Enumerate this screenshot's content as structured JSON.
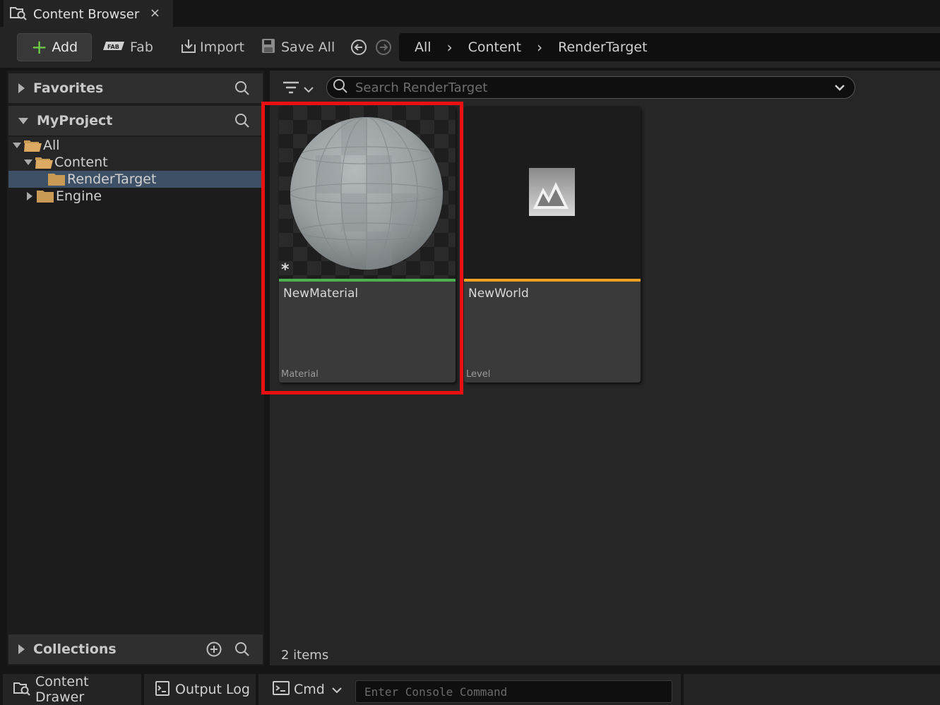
{
  "tab": {
    "title": "Content Browser",
    "close": "×"
  },
  "toolbar": {
    "add_label": "Add",
    "fab_label": "Fab",
    "import_label": "Import",
    "save_all_label": "Save All"
  },
  "breadcrumb": [
    "All",
    "Content",
    "RenderTarget"
  ],
  "sidebar": {
    "favorites_label": "Favorites",
    "project_label": "MyProject",
    "tree": [
      {
        "label": "All",
        "expanded": true
      },
      {
        "label": "Content",
        "expanded": true
      },
      {
        "label": "RenderTarget",
        "selected": true
      },
      {
        "label": "Engine",
        "expanded": false
      }
    ],
    "collections_label": "Collections"
  },
  "search": {
    "placeholder": "Search RenderTarget"
  },
  "assets": [
    {
      "name": "NewMaterial",
      "type": "Material",
      "bar_color": "#4caf50"
    },
    {
      "name": "NewWorld",
      "type": "Level",
      "bar_color": "#f0a020"
    }
  ],
  "status": {
    "item_count": "2 items"
  },
  "bottom": {
    "content_drawer": "Content Drawer",
    "output_log": "Output Log",
    "cmd": "Cmd",
    "console_placeholder": "Enter Console Command"
  },
  "colors": {
    "highlight": "#e81010",
    "accent_green": "#6fcf47",
    "selection": "#3e5066"
  }
}
